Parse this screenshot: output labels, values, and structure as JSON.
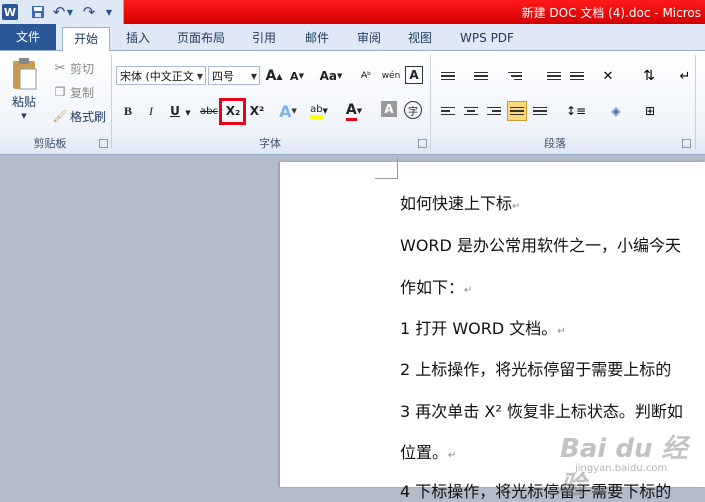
{
  "titlebar": {
    "title": "新建 DOC 文档 (4).doc - Micros",
    "accent": "#e8001c"
  },
  "quick_access": {
    "logo": "W"
  },
  "tabs": [
    {
      "label": "文件"
    },
    {
      "label": "开始"
    },
    {
      "label": "插入"
    },
    {
      "label": "页面布局"
    },
    {
      "label": "引用"
    },
    {
      "label": "邮件"
    },
    {
      "label": "审阅"
    },
    {
      "label": "视图"
    },
    {
      "label": "WPS PDF"
    }
  ],
  "clipboard": {
    "paste": "粘贴",
    "cut": "剪切",
    "copy": "复制",
    "format_painter": "格式刷",
    "group_label": "剪贴板"
  },
  "font": {
    "font_name": "宋体 (中文正文",
    "font_size": "四号",
    "grow": "A",
    "shrink": "A",
    "case": "Aa",
    "pinyin": "wén",
    "border": "A",
    "bold": "B",
    "italic": "I",
    "underline": "U",
    "strike": "abc",
    "subscript": "X₂",
    "superscript": "X²",
    "effects": "A",
    "highlight": "ab",
    "color": "A",
    "shading": "A",
    "enclose": "字",
    "group_label": "字体"
  },
  "paragraph": {
    "group_label": "段落"
  },
  "document": {
    "lines": [
      "如何快速上下标",
      "WORD 是办公常用软件之一，小编今天",
      "作如下：",
      "1 打开 WORD 文档。",
      "2 上标操作，将光标停留于需要上标的",
      "3 再次单击 X² 恢复非上标状态。判断如",
      "位置。",
      "4 下标操作，将光标停留于需要下标的"
    ],
    "squiggle_word": "小编今天"
  },
  "watermark": {
    "text": "Bai du 经验",
    "url": "jingyan.baidu.com"
  }
}
